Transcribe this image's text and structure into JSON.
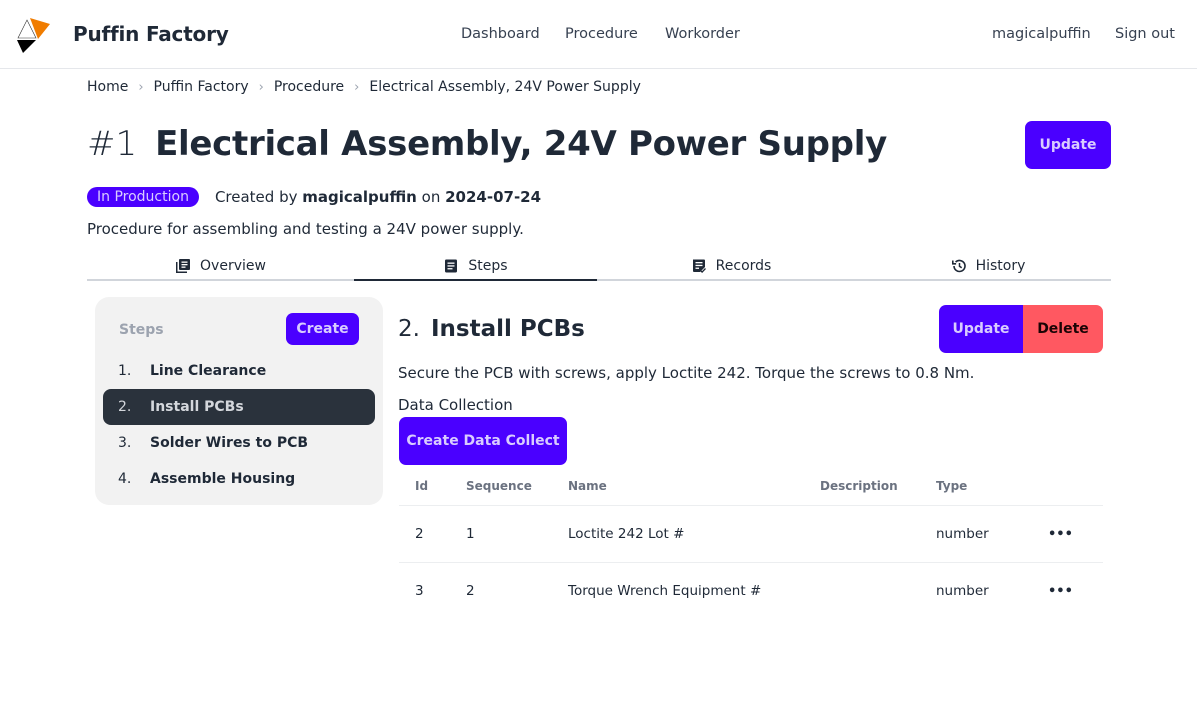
{
  "app": {
    "brand": "Puffin Factory",
    "colors": {
      "primary": "#4a00ff",
      "error": "#ff5861",
      "logo_orange": "#f07c00",
      "text": "#1f2937"
    }
  },
  "nav": {
    "links": [
      "Dashboard",
      "Procedure",
      "Workorder"
    ],
    "user": "magicalpuffin",
    "sign_out": "Sign out"
  },
  "breadcrumb": [
    "Home",
    "Puffin Factory",
    "Procedure",
    "Electrical Assembly, 24V Power Supply"
  ],
  "procedure": {
    "number": "#1",
    "title": "Electrical Assembly, 24V Power Supply",
    "update_label": "Update",
    "status": "In Production",
    "created_prefix": "Created by",
    "created_by": "magicalpuffin",
    "created_on_prefix": "on",
    "created_on": "2024-07-24",
    "description": "Procedure for assembling and testing a 24V power supply."
  },
  "tabs": [
    {
      "label": "Overview",
      "icon": "book-icon",
      "active": false
    },
    {
      "label": "Steps",
      "icon": "list-icon",
      "active": true
    },
    {
      "label": "Records",
      "icon": "records-check-icon",
      "active": false
    },
    {
      "label": "History",
      "icon": "history-icon",
      "active": false
    }
  ],
  "steps_panel": {
    "heading": "Steps",
    "create_label": "Create",
    "items": [
      {
        "num": "1.",
        "label": "Line Clearance",
        "active": false
      },
      {
        "num": "2.",
        "label": "Install PCBs",
        "active": true
      },
      {
        "num": "3.",
        "label": "Solder Wires to PCB",
        "active": false
      },
      {
        "num": "4.",
        "label": "Assemble Housing",
        "active": false
      }
    ]
  },
  "step": {
    "num": "2.",
    "title": "Install PCBs",
    "update_label": "Update",
    "delete_label": "Delete",
    "description": "Secure the PCB with screws, apply Loctite 242. Torque the screws to 0.8 Nm.",
    "data_collection_label": "Data Collection",
    "create_dc_label": "Create Data Collect",
    "table": {
      "headers": [
        "Id",
        "Sequence",
        "Name",
        "Description",
        "Type",
        ""
      ],
      "rows": [
        {
          "id": "2",
          "sequence": "1",
          "name": "Loctite 242 Lot #",
          "description": "",
          "type": "number",
          "menu": "•••"
        },
        {
          "id": "3",
          "sequence": "2",
          "name": "Torque Wrench Equipment #",
          "description": "",
          "type": "number",
          "menu": "•••"
        }
      ]
    }
  }
}
